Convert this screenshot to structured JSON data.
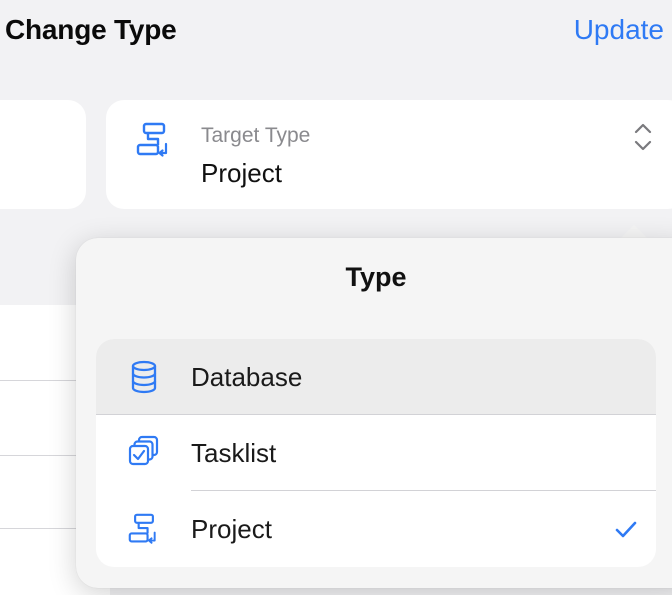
{
  "header": {
    "title": "Change Type",
    "update_label": "Update"
  },
  "target": {
    "label": "Target Type",
    "value": "Project",
    "icon": "project-icon"
  },
  "popover": {
    "title": "Type",
    "options": [
      {
        "label": "Database",
        "icon": "database-icon",
        "selected": false,
        "highlighted": true
      },
      {
        "label": "Tasklist",
        "icon": "tasklist-icon",
        "selected": false,
        "highlighted": false
      },
      {
        "label": "Project",
        "icon": "project-icon",
        "selected": true,
        "highlighted": false
      }
    ]
  },
  "colors": {
    "accent": "#2f7af4",
    "background": "#f2f2f4",
    "card": "#ffffff"
  }
}
